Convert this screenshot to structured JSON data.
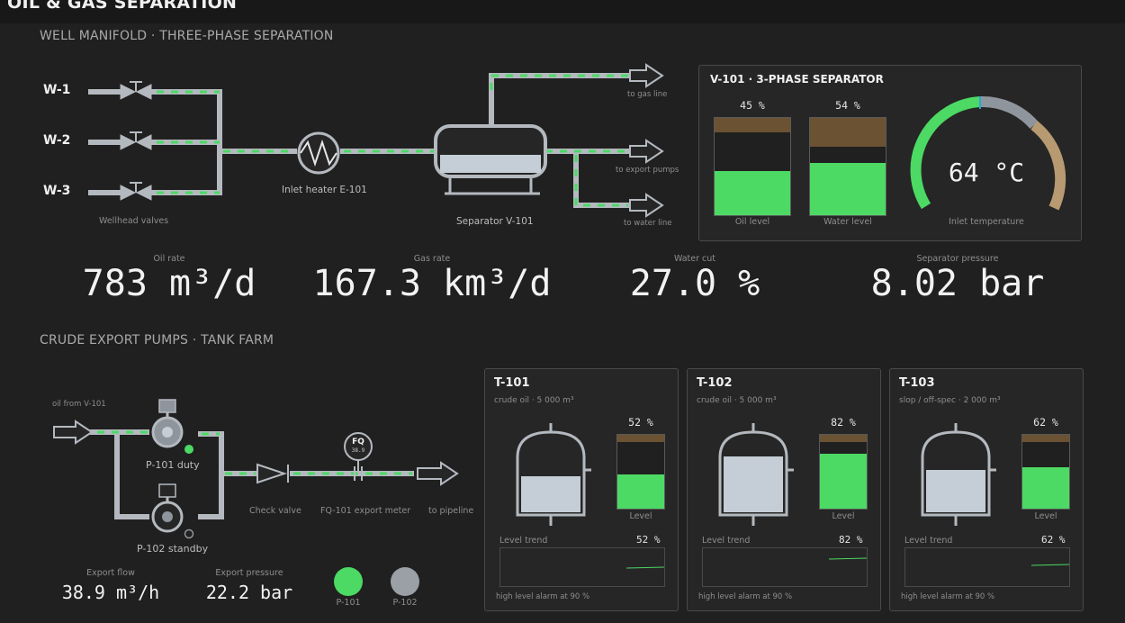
{
  "app": {
    "title": "OIL & GAS SEPARATION"
  },
  "manifold": {
    "section_title": "WELL MANIFOLD · THREE-PHASE SEPARATION",
    "wells": [
      "W-1",
      "W-2",
      "W-3"
    ],
    "wellhead_label": "Wellhead valves",
    "heater_label": "Inlet heater E-101",
    "separator_label": "Separator V-101",
    "to_gas": "to gas line",
    "to_export": "to export pumps",
    "to_water": "to water line"
  },
  "separator_panel": {
    "title": "V-101 · 3-PHASE SEPARATOR",
    "oil_level_pct": 45,
    "oil_level_text": "45 %",
    "oil_level_label": "Oil level",
    "water_level_pct": 54,
    "water_level_text": "54 %",
    "water_level_label": "Water level",
    "temp_text": "64 °C",
    "temp_label": "Inlet temperature"
  },
  "kpis": [
    {
      "label": "Oil rate",
      "value": "783 m³/d"
    },
    {
      "label": "Gas rate",
      "value": "167.3 km³/d"
    },
    {
      "label": "Water cut",
      "value": "27.0 %"
    },
    {
      "label": "Separator pressure",
      "value": "8.02 bar"
    }
  ],
  "pumps": {
    "section_title": "CRUDE EXPORT PUMPS · TANK FARM",
    "oil_from": "oil from V-101",
    "p101_label": "P-101 duty",
    "p102_label": "P-102 standby",
    "check_valve": "Check valve",
    "meter_tag": "FQ",
    "meter_value": "38.9",
    "meter_label": "FQ-101 export meter",
    "to_pipeline": "to pipeline",
    "export_flow_label": "Export flow",
    "export_flow_value": "38.9 m³/h",
    "export_pressure_label": "Export pressure",
    "export_pressure_value": "22.2 bar",
    "status": [
      {
        "name": "P-101",
        "color": "#4cd964"
      },
      {
        "name": "P-102",
        "color": "#9aa0a6"
      }
    ]
  },
  "tanks": [
    {
      "name": "T-101",
      "sub": "crude oil · 5 000 m³",
      "level_pct": 52,
      "level_text": "52 %",
      "level_label": "Level",
      "trend_label": "Level trend",
      "trend_value": "52 %",
      "alarm": "high level alarm at 90 %"
    },
    {
      "name": "T-102",
      "sub": "crude oil · 5 000 m³",
      "level_pct": 82,
      "level_text": "82 %",
      "level_label": "Level",
      "trend_label": "Level trend",
      "trend_value": "82 %",
      "alarm": "high level alarm at 90 %"
    },
    {
      "name": "T-103",
      "sub": "slop / off-spec · 2 000 m³",
      "level_pct": 62,
      "level_text": "62 %",
      "level_label": "Level",
      "trend_label": "Level trend",
      "trend_value": "62 %",
      "alarm": "high level alarm at 90 %"
    }
  ],
  "colors": {
    "green": "#4cd964",
    "brown": "#6b5232",
    "pipe": "#b4b9bf",
    "tan": "#b79a72"
  }
}
